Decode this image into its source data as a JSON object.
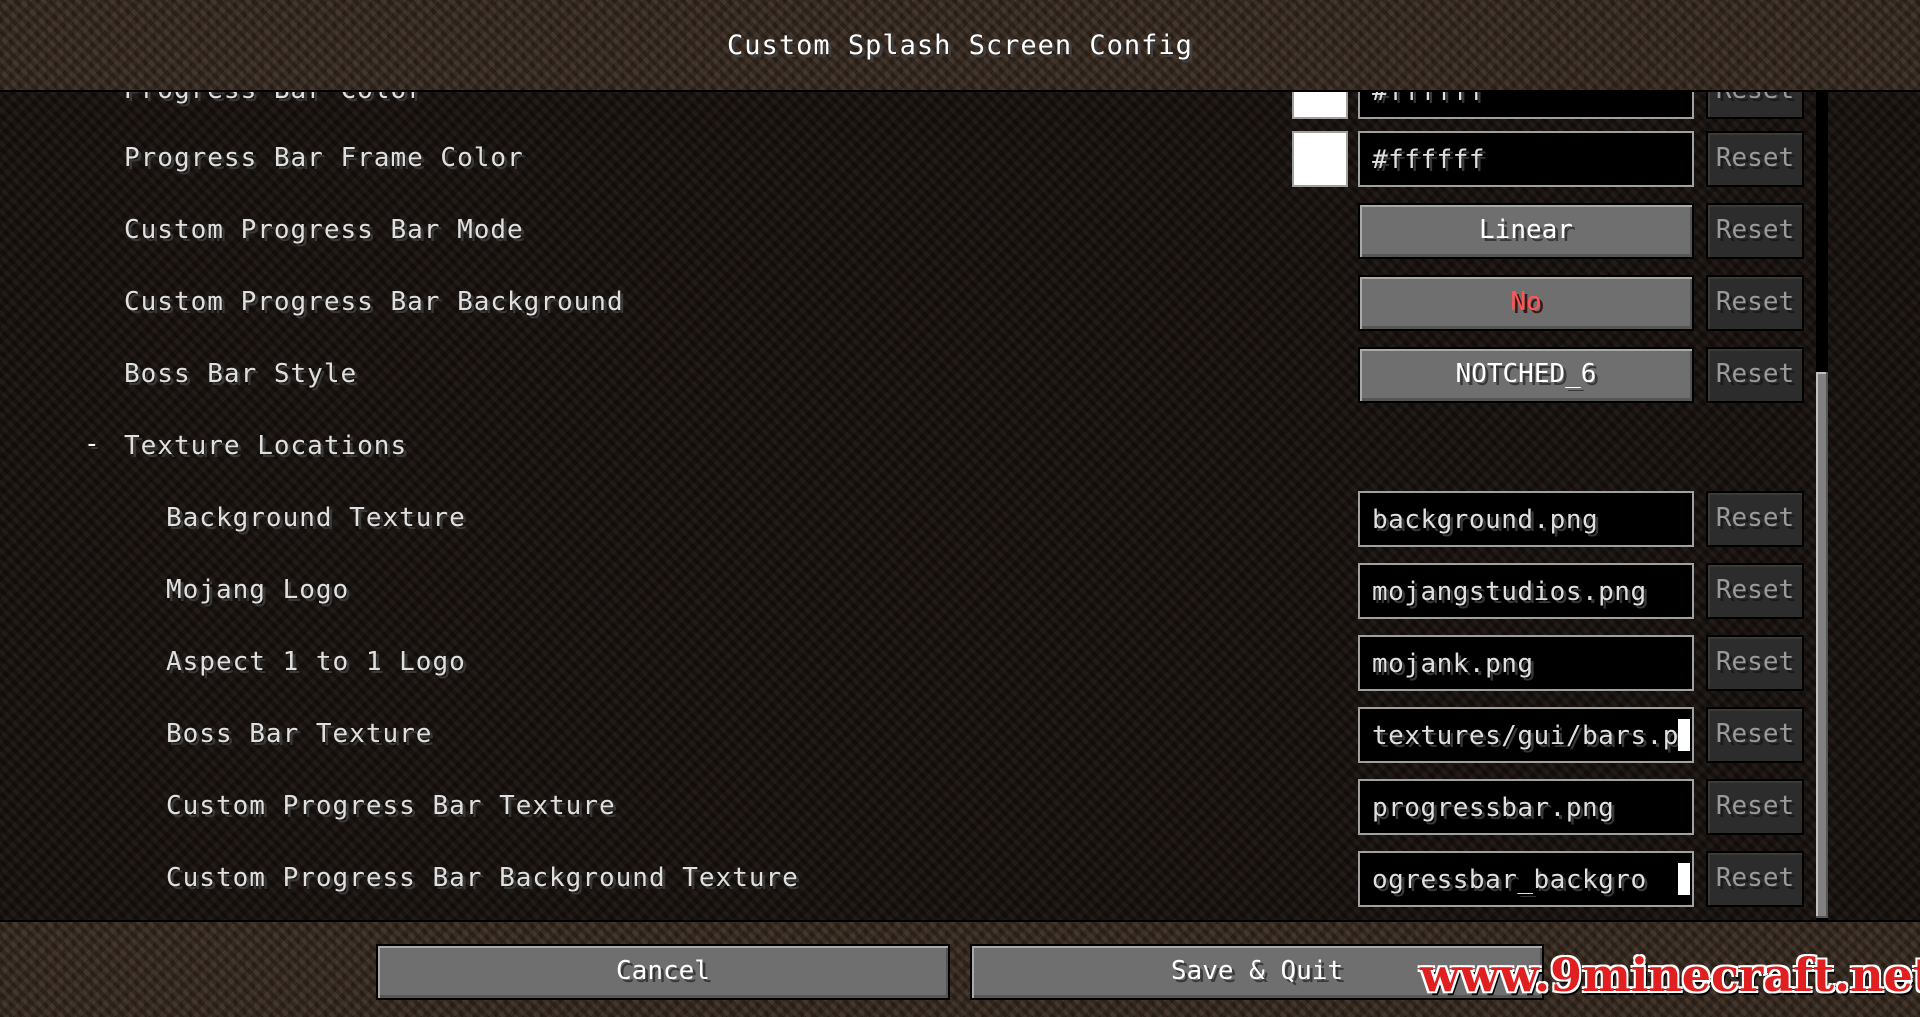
{
  "window": {
    "title": "Custom Splash Screen Config"
  },
  "options": {
    "partial_row": {
      "label": "Progress Bar Color",
      "swatch_color": "#ffffff",
      "value": "#ffffff",
      "reset_label": "Reset"
    },
    "frame_color": {
      "label": "Progress Bar Frame Color",
      "swatch_color": "#ffffff",
      "value": "#ffffff",
      "reset_label": "Reset"
    },
    "progress_mode": {
      "label": "Custom Progress Bar Mode",
      "value": "Linear",
      "reset_label": "Reset"
    },
    "progress_background": {
      "label": "Custom Progress Bar Background",
      "value": "No",
      "value_color": "#ff5555",
      "reset_label": "Reset"
    },
    "boss_bar_style": {
      "label": "Boss Bar Style",
      "value": "NOTCHED_6",
      "reset_label": "Reset"
    }
  },
  "texture_section": {
    "toggle_symbol": "-",
    "title": "Texture Locations",
    "items": [
      {
        "label": "Background Texture",
        "value": "background.png",
        "reset_label": "Reset",
        "focused": false
      },
      {
        "label": "Mojang Logo",
        "value": "mojangstudios.png",
        "reset_label": "Reset",
        "focused": false
      },
      {
        "label": "Aspect 1 to 1 Logo",
        "value": "mojank.png",
        "reset_label": "Reset",
        "focused": false
      },
      {
        "label": "Boss Bar Texture",
        "value": "textures/gui/bars.p",
        "reset_label": "Reset",
        "focused": true
      },
      {
        "label": "Custom Progress Bar Texture",
        "value": "progressbar.png",
        "reset_label": "Reset",
        "focused": false
      },
      {
        "label": "Custom Progress Bar Background Texture",
        "value": "ogressbar_backgro",
        "reset_label": "Reset",
        "focused": true
      }
    ]
  },
  "footer": {
    "cancel_label": "Cancel",
    "save_label": "Save & Quit"
  },
  "watermark": {
    "text": "www.9minecraft.net"
  },
  "scroll": {
    "position_fraction": 0.66
  }
}
